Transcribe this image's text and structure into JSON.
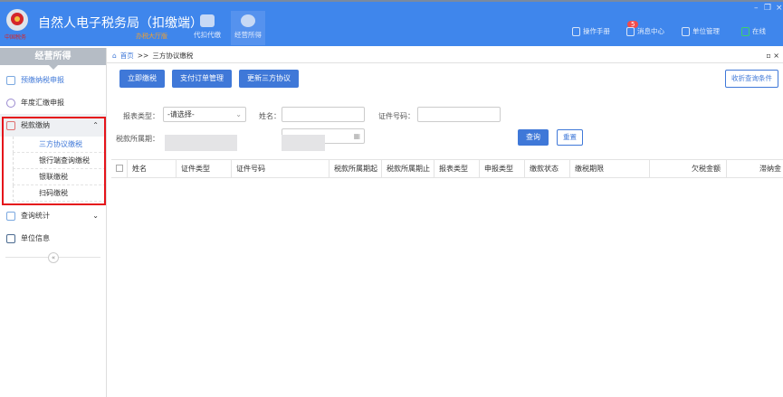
{
  "header": {
    "title": "自然人电子税务局（扣缴端）",
    "subtitle": "办税大厅版",
    "logo_text": "中国税务",
    "tabs": [
      {
        "label": "代扣代缴",
        "icon": "wallet-icon"
      },
      {
        "label": "经营所得",
        "icon": "coins-icon",
        "active": true
      }
    ],
    "right": [
      {
        "label": "操作手册",
        "icon": "document-icon"
      },
      {
        "label": "消息中心",
        "icon": "mail-icon",
        "badge": "5"
      },
      {
        "label": "单位管理",
        "icon": "building-icon"
      },
      {
        "label": "在线",
        "icon": "monitor-icon"
      }
    ]
  },
  "sidebar": {
    "title": "经营所得",
    "items": [
      {
        "label": "预缴纳税申报"
      },
      {
        "label": "年度汇缴申报"
      },
      {
        "label": "税款缴纳",
        "expanded": true,
        "children": [
          "三方协议缴税",
          "银行端查询缴税",
          "银联缴税",
          "扫码缴税"
        ]
      },
      {
        "label": "查询统计"
      },
      {
        "label": "单位信息"
      }
    ],
    "collapse": "«"
  },
  "breadcrumb": {
    "home": "首页",
    "sep": ">>",
    "current": "三方协议缴税"
  },
  "toolbar": {
    "b1": "立即缴税",
    "b2": "支付订单管理",
    "b3": "更新三方协议",
    "collapse": "收折查询条件"
  },
  "form": {
    "report_type_label": "报表类型：",
    "report_type_value": "-请选择-",
    "name_label": "姓名：",
    "id_label": "证件号码：",
    "period_label": "税款所属期：",
    "query": "查询",
    "reset": "重置"
  },
  "table": {
    "headers": [
      "姓名",
      "证件类型",
      "证件号码",
      "税款所属期起",
      "税款所属期止",
      "报表类型",
      "申报类型",
      "缴款状态",
      "缴税期限",
      "欠税金额",
      "滞纳金"
    ]
  },
  "colors": {
    "header": "#3f86ec",
    "accent": "#3f78d8",
    "highlight": "#e5141b"
  }
}
